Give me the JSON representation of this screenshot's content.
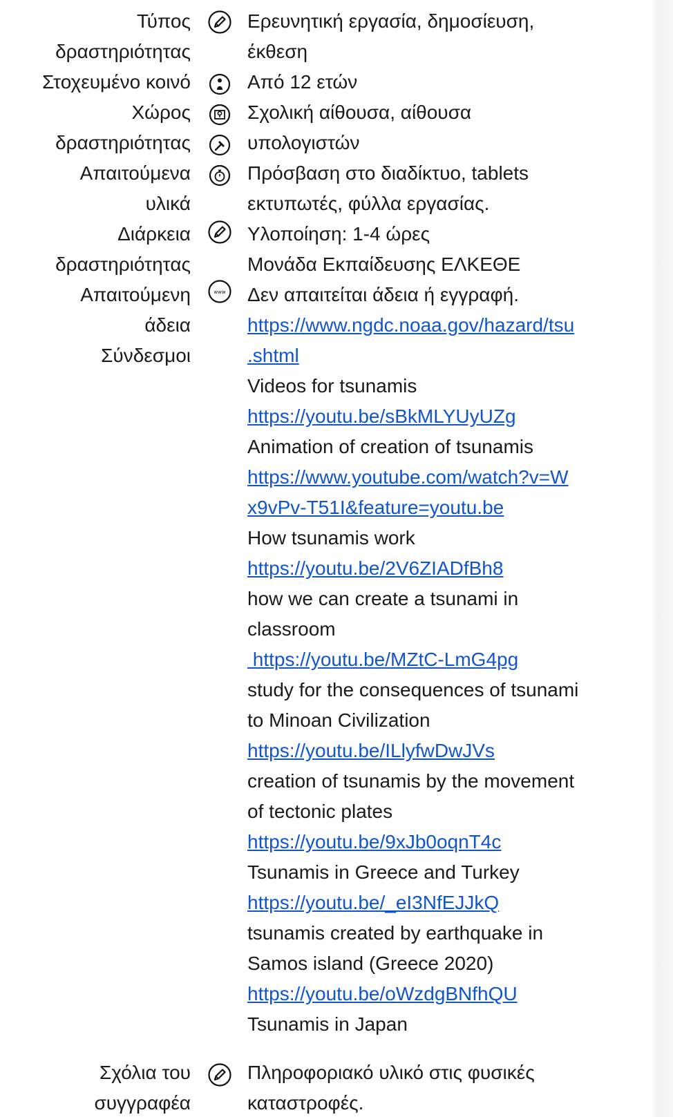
{
  "fields": {
    "activity_type": {
      "label_1": "Τύπος",
      "label_2": "δραστηριότητας",
      "value_1": "Ερευνητική εργασία, δημοσίευση,",
      "value_2": "έκθεση"
    },
    "audience": {
      "label": "Στοχευμένο κοινό",
      "value": "Από 12 ετών"
    },
    "venue": {
      "label_1": "Χώρος",
      "label_2": "δραστηριότητας",
      "value_1": "Σχολική αίθουσα, αίθουσα",
      "value_2": "υπολογιστών"
    },
    "materials": {
      "label_1": "Απαιτούμενα",
      "label_2": "υλικά",
      "value_1": "Πρόσβαση στο διαδίκτυο, tablets",
      "value_2": "εκτυπωτές, φύλλα εργασίας."
    },
    "duration": {
      "label_1": "Διάρκεια",
      "label_2": "δραστηριότητας",
      "value_1": "Υλοποίηση:  1-4  ώρες",
      "value_2": "Μονάδα Εκπαίδευσης ΕΛΚΕΘΕ"
    },
    "permission": {
      "label_1": "Απαιτούμενη",
      "label_2": "άδεια",
      "value": "Δεν απαιτείται άδεια ή εγγραφή."
    },
    "links": {
      "label": "Σύνδεσμοι",
      "url_1a": "https://www.ngdc.noaa.gov/hazard/tsu",
      "url_1b": ".shtml",
      "desc_2": "Videos for tsunamis",
      "url_2": "https://youtu.be/sBkMLYUyUZg",
      "desc_3": "Animation of creation of tsunamis",
      "url_3a": "https://www.youtube.com/watch?v=W",
      "url_3b": "x9vPv-T51I&feature=youtu.be",
      "desc_4": "How tsunamis work",
      "url_4": "https://youtu.be/2V6ZIADfBh8",
      "desc_5a": "how we can create a tsunami in",
      "desc_5b": "classroom",
      "url_5": " https://youtu.be/MZtC-LmG4pg",
      "desc_6a": "study for the consequences of tsunami",
      "desc_6b": "to Minoan Civilization",
      "url_6": "https://youtu.be/ILlyfwDwJVs",
      "desc_7a": "creation of tsunamis by the movement",
      "desc_7b": "of tectonic plates",
      "url_7": "https://youtu.be/9xJb0oqnT4c",
      "desc_8": "Tsunamis in Greece and Turkey",
      "url_8": "https://youtu.be/_eI3NfEJJkQ",
      "desc_9a": "tsunamis created by earthquake in",
      "desc_9b": "Samos island (Greece 2020)",
      "url_9": "https://youtu.be/oWzdgBNfhQU",
      "desc_10": "Tsunamis in Japan"
    },
    "author_comments": {
      "label_1": "Σχόλια του",
      "label_2": "συγγραφέα",
      "value_1": "Πληροφοριακό υλικό στις φυσικές",
      "value_2": "καταστροφές."
    }
  },
  "icons": {
    "activity_type": "pencil-icon",
    "audience": "person-icon",
    "venue": "map-pin-icon",
    "venue_2": "hammer-icon",
    "materials": "stopwatch-icon",
    "duration": "pencil-icon",
    "permission": "www-icon",
    "author_comments": "pencil-icon"
  },
  "colors": {
    "text": "#1a1a1a",
    "link": "#1155cc"
  }
}
